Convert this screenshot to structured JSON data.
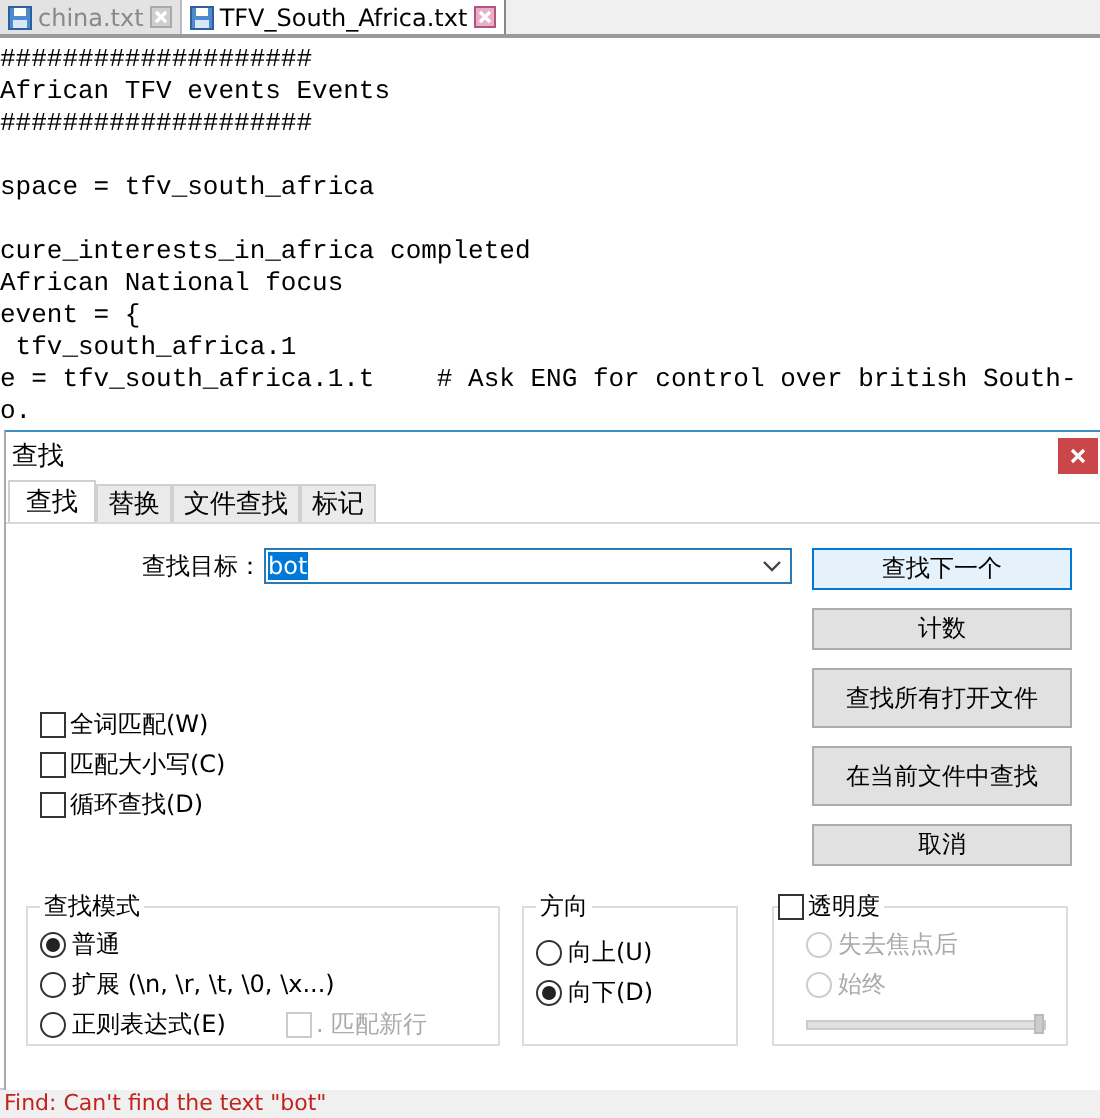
{
  "file_tabs": [
    {
      "label": "china.txt",
      "selected": false
    },
    {
      "label": "TFV_South_Africa.txt",
      "selected": true
    }
  ],
  "editor": {
    "blocks": [
      [
        "####################",
        "African TFV events Events",
        "####################"
      ],
      [
        "space = tfv_south_africa"
      ],
      [
        "cure_interests_in_africa completed",
        "African National focus",
        "event = {",
        " tfv_south_africa.1",
        "e = tfv_south_africa.1.t    # Ask ENG for control over british South-",
        "o."
      ]
    ]
  },
  "dialog": {
    "title": "查找",
    "tabs": [
      {
        "label": "查找",
        "selected": true
      },
      {
        "label": "替换",
        "selected": false
      },
      {
        "label": "文件查找",
        "selected": false
      },
      {
        "label": "标记",
        "selected": false
      }
    ],
    "find_label": "查找目标：",
    "find_value": "bot",
    "buttons": [
      {
        "label": "查找下一个",
        "default": true
      },
      {
        "label": "计数",
        "default": false
      },
      {
        "label": "查找所有打开文件",
        "default": false
      },
      {
        "label": "在当前文件中查找",
        "default": false
      },
      {
        "label": "取消",
        "default": false
      }
    ],
    "options": [
      {
        "label": "全词匹配(W)",
        "checked": false
      },
      {
        "label": "匹配大小写(C)",
        "checked": false
      },
      {
        "label": "循环查找(D)",
        "checked": false
      }
    ],
    "search_mode": {
      "title": "查找模式",
      "options": [
        {
          "label": "普通",
          "selected": true
        },
        {
          "label": "扩展 (\\n, \\r, \\t, \\0, \\x...)",
          "selected": false
        },
        {
          "label": "正则表达式(E)",
          "selected": false
        }
      ],
      "dot_newline": {
        "label": ". 匹配新行",
        "checked": false,
        "disabled": true
      }
    },
    "direction": {
      "title": "方向",
      "options": [
        {
          "label": "向上(U)",
          "selected": false
        },
        {
          "label": "向下(D)",
          "selected": true
        }
      ]
    },
    "transparency": {
      "label": "透明度",
      "checked": false,
      "options": [
        {
          "label": "失去焦点后",
          "selected": false,
          "disabled": true
        },
        {
          "label": "始终",
          "selected": false,
          "disabled": true
        }
      ],
      "level": 1
    }
  },
  "status_bar": "Find: Can't find the text \"bot\""
}
